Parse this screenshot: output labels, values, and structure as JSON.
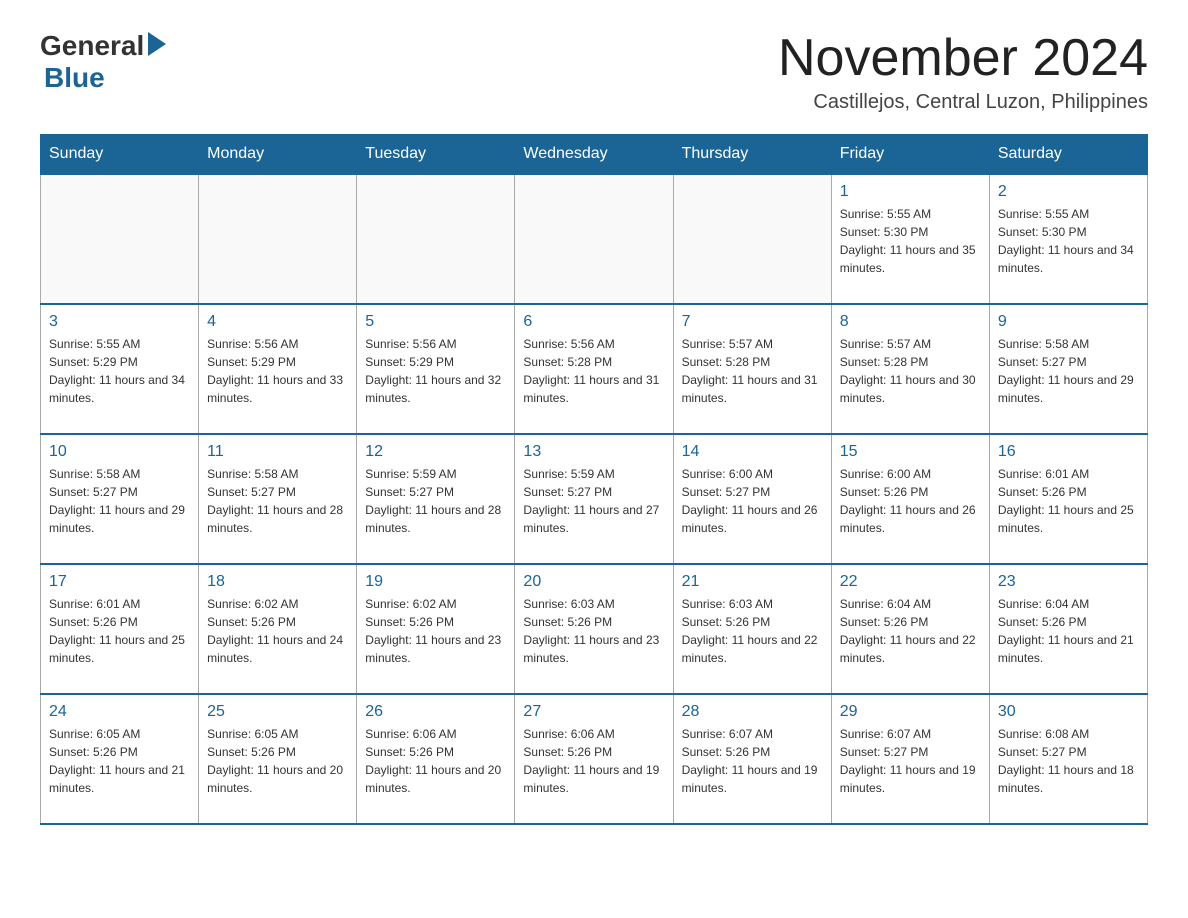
{
  "header": {
    "logo_general": "General",
    "logo_blue": "Blue",
    "month_title": "November 2024",
    "location": "Castillejos, Central Luzon, Philippines"
  },
  "days_of_week": [
    "Sunday",
    "Monday",
    "Tuesday",
    "Wednesday",
    "Thursday",
    "Friday",
    "Saturday"
  ],
  "weeks": [
    [
      {
        "day": "",
        "sunrise": "",
        "sunset": "",
        "daylight": ""
      },
      {
        "day": "",
        "sunrise": "",
        "sunset": "",
        "daylight": ""
      },
      {
        "day": "",
        "sunrise": "",
        "sunset": "",
        "daylight": ""
      },
      {
        "day": "",
        "sunrise": "",
        "sunset": "",
        "daylight": ""
      },
      {
        "day": "",
        "sunrise": "",
        "sunset": "",
        "daylight": ""
      },
      {
        "day": "1",
        "sunrise": "Sunrise: 5:55 AM",
        "sunset": "Sunset: 5:30 PM",
        "daylight": "Daylight: 11 hours and 35 minutes."
      },
      {
        "day": "2",
        "sunrise": "Sunrise: 5:55 AM",
        "sunset": "Sunset: 5:30 PM",
        "daylight": "Daylight: 11 hours and 34 minutes."
      }
    ],
    [
      {
        "day": "3",
        "sunrise": "Sunrise: 5:55 AM",
        "sunset": "Sunset: 5:29 PM",
        "daylight": "Daylight: 11 hours and 34 minutes."
      },
      {
        "day": "4",
        "sunrise": "Sunrise: 5:56 AM",
        "sunset": "Sunset: 5:29 PM",
        "daylight": "Daylight: 11 hours and 33 minutes."
      },
      {
        "day": "5",
        "sunrise": "Sunrise: 5:56 AM",
        "sunset": "Sunset: 5:29 PM",
        "daylight": "Daylight: 11 hours and 32 minutes."
      },
      {
        "day": "6",
        "sunrise": "Sunrise: 5:56 AM",
        "sunset": "Sunset: 5:28 PM",
        "daylight": "Daylight: 11 hours and 31 minutes."
      },
      {
        "day": "7",
        "sunrise": "Sunrise: 5:57 AM",
        "sunset": "Sunset: 5:28 PM",
        "daylight": "Daylight: 11 hours and 31 minutes."
      },
      {
        "day": "8",
        "sunrise": "Sunrise: 5:57 AM",
        "sunset": "Sunset: 5:28 PM",
        "daylight": "Daylight: 11 hours and 30 minutes."
      },
      {
        "day": "9",
        "sunrise": "Sunrise: 5:58 AM",
        "sunset": "Sunset: 5:27 PM",
        "daylight": "Daylight: 11 hours and 29 minutes."
      }
    ],
    [
      {
        "day": "10",
        "sunrise": "Sunrise: 5:58 AM",
        "sunset": "Sunset: 5:27 PM",
        "daylight": "Daylight: 11 hours and 29 minutes."
      },
      {
        "day": "11",
        "sunrise": "Sunrise: 5:58 AM",
        "sunset": "Sunset: 5:27 PM",
        "daylight": "Daylight: 11 hours and 28 minutes."
      },
      {
        "day": "12",
        "sunrise": "Sunrise: 5:59 AM",
        "sunset": "Sunset: 5:27 PM",
        "daylight": "Daylight: 11 hours and 28 minutes."
      },
      {
        "day": "13",
        "sunrise": "Sunrise: 5:59 AM",
        "sunset": "Sunset: 5:27 PM",
        "daylight": "Daylight: 11 hours and 27 minutes."
      },
      {
        "day": "14",
        "sunrise": "Sunrise: 6:00 AM",
        "sunset": "Sunset: 5:27 PM",
        "daylight": "Daylight: 11 hours and 26 minutes."
      },
      {
        "day": "15",
        "sunrise": "Sunrise: 6:00 AM",
        "sunset": "Sunset: 5:26 PM",
        "daylight": "Daylight: 11 hours and 26 minutes."
      },
      {
        "day": "16",
        "sunrise": "Sunrise: 6:01 AM",
        "sunset": "Sunset: 5:26 PM",
        "daylight": "Daylight: 11 hours and 25 minutes."
      }
    ],
    [
      {
        "day": "17",
        "sunrise": "Sunrise: 6:01 AM",
        "sunset": "Sunset: 5:26 PM",
        "daylight": "Daylight: 11 hours and 25 minutes."
      },
      {
        "day": "18",
        "sunrise": "Sunrise: 6:02 AM",
        "sunset": "Sunset: 5:26 PM",
        "daylight": "Daylight: 11 hours and 24 minutes."
      },
      {
        "day": "19",
        "sunrise": "Sunrise: 6:02 AM",
        "sunset": "Sunset: 5:26 PM",
        "daylight": "Daylight: 11 hours and 23 minutes."
      },
      {
        "day": "20",
        "sunrise": "Sunrise: 6:03 AM",
        "sunset": "Sunset: 5:26 PM",
        "daylight": "Daylight: 11 hours and 23 minutes."
      },
      {
        "day": "21",
        "sunrise": "Sunrise: 6:03 AM",
        "sunset": "Sunset: 5:26 PM",
        "daylight": "Daylight: 11 hours and 22 minutes."
      },
      {
        "day": "22",
        "sunrise": "Sunrise: 6:04 AM",
        "sunset": "Sunset: 5:26 PM",
        "daylight": "Daylight: 11 hours and 22 minutes."
      },
      {
        "day": "23",
        "sunrise": "Sunrise: 6:04 AM",
        "sunset": "Sunset: 5:26 PM",
        "daylight": "Daylight: 11 hours and 21 minutes."
      }
    ],
    [
      {
        "day": "24",
        "sunrise": "Sunrise: 6:05 AM",
        "sunset": "Sunset: 5:26 PM",
        "daylight": "Daylight: 11 hours and 21 minutes."
      },
      {
        "day": "25",
        "sunrise": "Sunrise: 6:05 AM",
        "sunset": "Sunset: 5:26 PM",
        "daylight": "Daylight: 11 hours and 20 minutes."
      },
      {
        "day": "26",
        "sunrise": "Sunrise: 6:06 AM",
        "sunset": "Sunset: 5:26 PM",
        "daylight": "Daylight: 11 hours and 20 minutes."
      },
      {
        "day": "27",
        "sunrise": "Sunrise: 6:06 AM",
        "sunset": "Sunset: 5:26 PM",
        "daylight": "Daylight: 11 hours and 19 minutes."
      },
      {
        "day": "28",
        "sunrise": "Sunrise: 6:07 AM",
        "sunset": "Sunset: 5:26 PM",
        "daylight": "Daylight: 11 hours and 19 minutes."
      },
      {
        "day": "29",
        "sunrise": "Sunrise: 6:07 AM",
        "sunset": "Sunset: 5:27 PM",
        "daylight": "Daylight: 11 hours and 19 minutes."
      },
      {
        "day": "30",
        "sunrise": "Sunrise: 6:08 AM",
        "sunset": "Sunset: 5:27 PM",
        "daylight": "Daylight: 11 hours and 18 minutes."
      }
    ]
  ]
}
